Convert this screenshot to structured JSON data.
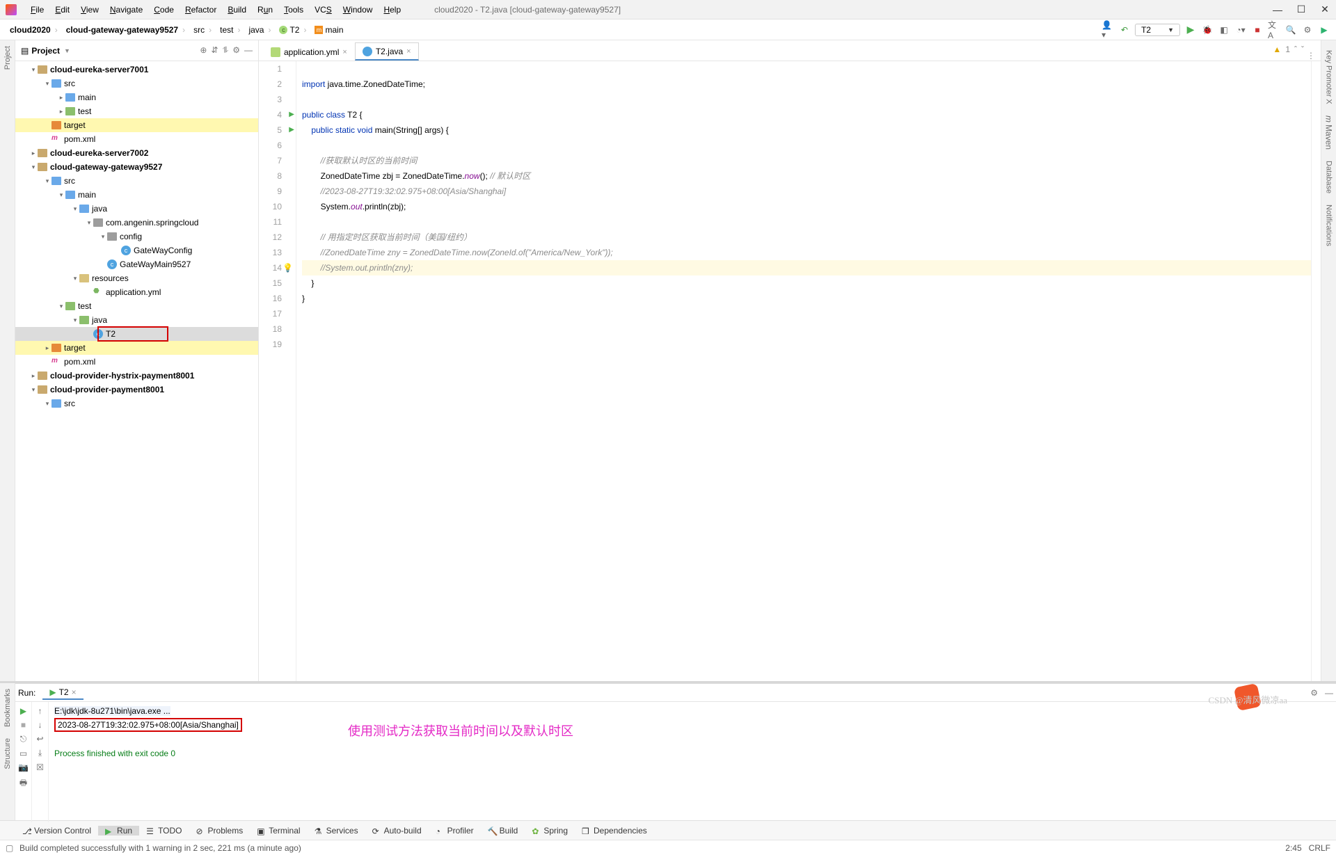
{
  "window": {
    "title": "cloud2020 - T2.java [cloud-gateway-gateway9527]"
  },
  "menu": [
    "File",
    "Edit",
    "View",
    "Navigate",
    "Code",
    "Refactor",
    "Build",
    "Run",
    "Tools",
    "VCS",
    "Window",
    "Help"
  ],
  "breadcrumbs": {
    "c0": "cloud2020",
    "c1": "cloud-gateway-gateway9527",
    "c2": "src",
    "c3": "test",
    "c4": "java",
    "c5": "T2",
    "c6": "main"
  },
  "runConfig": "T2",
  "projectPanel": {
    "title": "Project"
  },
  "tree": {
    "n0": "cloud-eureka-server7001",
    "n1": "src",
    "n2": "main",
    "n3": "test",
    "n4": "target",
    "n5": "pom.xml",
    "n6": "cloud-eureka-server7002",
    "n7": "cloud-gateway-gateway9527",
    "n8": "src",
    "n9": "main",
    "n10": "java",
    "n11": "com.angenin.springcloud",
    "n12": "config",
    "n13": "GateWayConfig",
    "n14": "GateWayMain9527",
    "n15": "resources",
    "n16": "application.yml",
    "n17": "test",
    "n18": "java",
    "n19": "T2",
    "n20": "target",
    "n21": "pom.xml",
    "n22": "cloud-provider-hystrix-payment8001",
    "n23": "cloud-provider-payment8001",
    "n24": "src"
  },
  "tabs": {
    "t0": "application.yml",
    "t1": "T2.java"
  },
  "code": {
    "l2": "import java.time.ZonedDateTime;",
    "l4a": "public class",
    "l4b": " T2 {",
    "l5a": "    public static void",
    "l5b": " main(String[] args) {",
    "l7": "        //获取默认时区的当前时间",
    "l8a": "        ZonedDateTime zbj = ZonedDateTime.",
    "l8b": "now",
    "l8c": "(); ",
    "l8d": "// 默认时区",
    "l9": "        //2023-08-27T19:32:02.975+08:00[Asia/Shanghai]",
    "l10a": "        System.",
    "l10b": "out",
    "l10c": ".println(zbj);",
    "l12": "        // 用指定时区获取当前时间（美国/纽约）",
    "l13": "        //ZonedDateTime zny = ZonedDateTime.now(ZoneId.of(\"America/New_York\"));",
    "l14": "        //System.out.println(zny);",
    "l15": "    }",
    "l16": "}"
  },
  "gutterLines": [
    "1",
    "2",
    "3",
    "4",
    "5",
    "6",
    "7",
    "8",
    "9",
    "10",
    "11",
    "12",
    "13",
    "14",
    "15",
    "16",
    "17",
    "18",
    "19"
  ],
  "editorStatus": {
    "warnCount": "1"
  },
  "run": {
    "label": "Run:",
    "tab": "T2",
    "line1": "E:\\jdk\\jdk-8u271\\bin\\java.exe ...",
    "line2": "2023-08-27T19:32:02.975+08:00[Asia/Shanghai]",
    "line3": "Process finished with exit code 0",
    "annotation": "使用测试方法获取当前时间以及默认时区"
  },
  "toolStrip": {
    "version": "Version Control",
    "run": "Run",
    "todo": "TODO",
    "problems": "Problems",
    "terminal": "Terminal",
    "services": "Services",
    "autobuild": "Auto-build",
    "profiler": "Profiler",
    "build": "Build",
    "spring": "Spring",
    "deps": "Dependencies"
  },
  "status": {
    "msg": "Build completed successfully with 1 warning in 2 sec, 221 ms (a minute ago)",
    "pos": "2:45",
    "enc": "CRLF"
  },
  "sideLeft": {
    "project": "Project",
    "bookmarks": "Bookmarks",
    "structure": "Structure"
  },
  "sideRight": {
    "kpx": "Key Promoter X",
    "maven": "Maven",
    "db": "Database",
    "notif": "Notifications"
  },
  "watermark": "CSDN @清风微凉aa"
}
